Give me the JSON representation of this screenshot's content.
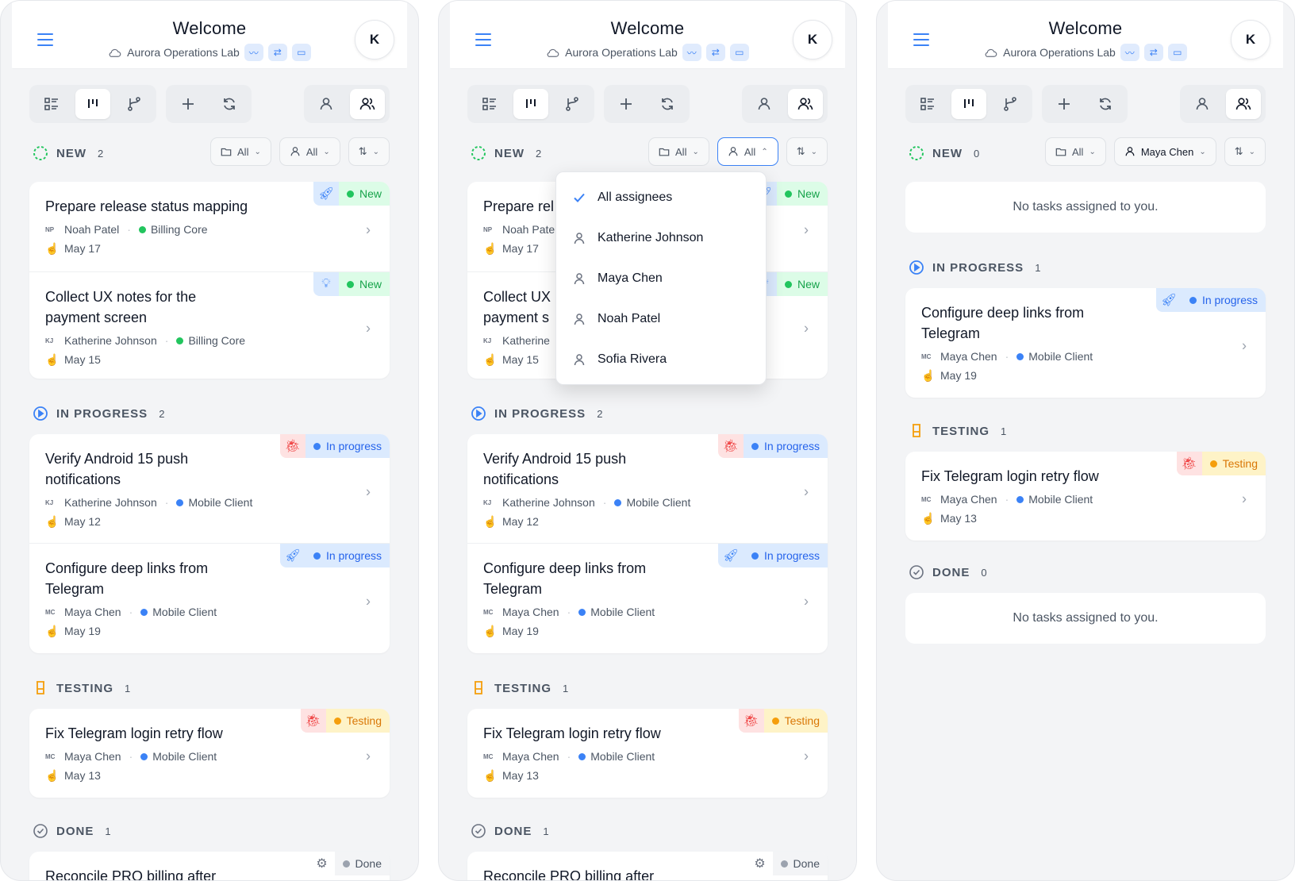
{
  "header": {
    "title": "Welcome",
    "workspace": "Aurora Operations Lab",
    "avatar_initial": "K"
  },
  "sections": {
    "new": "NEW",
    "in_progress": "IN PROGRESS",
    "testing": "TESTING",
    "done": "DONE"
  },
  "filters": {
    "project_all": "All",
    "assignee_all": "All",
    "assignee_selected": "Maya Chen"
  },
  "counts": {
    "p1": {
      "new": "2",
      "in_progress": "2",
      "testing": "1",
      "done": "1"
    },
    "p2": {
      "new": "2",
      "in_progress": "2",
      "testing": "1",
      "done": "1"
    },
    "p3": {
      "new": "0",
      "in_progress": "1",
      "testing": "1",
      "done": "0"
    }
  },
  "statuses": {
    "new": "New",
    "in_progress": "In progress",
    "testing": "Testing",
    "done": "Done"
  },
  "colors": {
    "new": "#22c55e",
    "in_progress": "#3b82f6",
    "testing": "#f59e0b",
    "done": "#9ca3af",
    "accent": "#3b82f6"
  },
  "tasks": {
    "t1": {
      "title": "Prepare release status mapping",
      "title_short": "Prepare rel",
      "initials": "NP",
      "assignee": "Noah Patel",
      "assignee_short": "Noah Pate",
      "project": "Billing Core",
      "date": "May 17"
    },
    "t2": {
      "title": "Collect UX notes for the payment screen",
      "title_short_1": "Collect UX",
      "title_short_2": "payment s",
      "initials": "KJ",
      "assignee": "Katherine Johnson",
      "assignee_short": "Katherine",
      "project": "Billing Core",
      "date": "May 15"
    },
    "t3": {
      "title": "Verify Android 15 push notifications",
      "initials": "KJ",
      "assignee": "Katherine Johnson",
      "project": "Mobile Client",
      "date": "May 12"
    },
    "t4": {
      "title": "Configure deep links from Telegram",
      "initials": "MC",
      "assignee": "Maya Chen",
      "project": "Mobile Client",
      "date": "May 19"
    },
    "t5": {
      "title": "Fix Telegram login retry flow",
      "initials": "MC",
      "assignee": "Maya Chen",
      "project": "Mobile Client",
      "date": "May 13"
    },
    "t6": {
      "title": "Reconcile PRO billing after"
    }
  },
  "empty_message": "No tasks assigned to you.",
  "assignee_menu": {
    "items": [
      "All assignees",
      "Katherine Johnson",
      "Maya Chen",
      "Noah Patel",
      "Sofia Rivera"
    ]
  }
}
